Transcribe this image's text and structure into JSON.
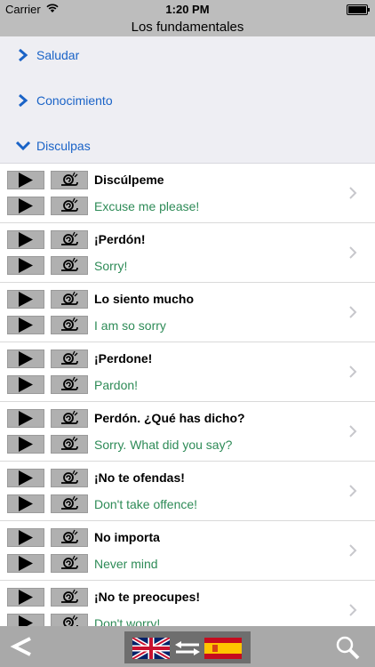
{
  "status": {
    "carrier": "Carrier",
    "time": "1:20 PM"
  },
  "title": "Los fundamentales",
  "categories": [
    {
      "label": "Saludar",
      "icon": "chevron-right-icon"
    },
    {
      "label": "Conocimiento",
      "icon": "chevron-right-icon"
    },
    {
      "label": "Disculpas",
      "icon": "chevron-down-icon"
    }
  ],
  "phrases": [
    {
      "es": "Discúlpeme",
      "en": "Excuse me please!"
    },
    {
      "es": "¡Perdón!",
      "en": "Sorry!"
    },
    {
      "es": "Lo siento mucho",
      "en": "I am so sorry"
    },
    {
      "es": "¡Perdone!",
      "en": "Pardon!"
    },
    {
      "es": "Perdón. ¿Qué has dicho?",
      "en": "Sorry. What did you say?"
    },
    {
      "es": "¡No te ofendas!",
      "en": "Don't take offence!"
    },
    {
      "es": "No importa",
      "en": "Never mind"
    },
    {
      "es": "¡No te preocupes!",
      "en": "Don't worry!"
    }
  ],
  "colors": {
    "accent": "#1a63c7",
    "translation": "#2e8b57",
    "bar": "#bdbdbd"
  }
}
